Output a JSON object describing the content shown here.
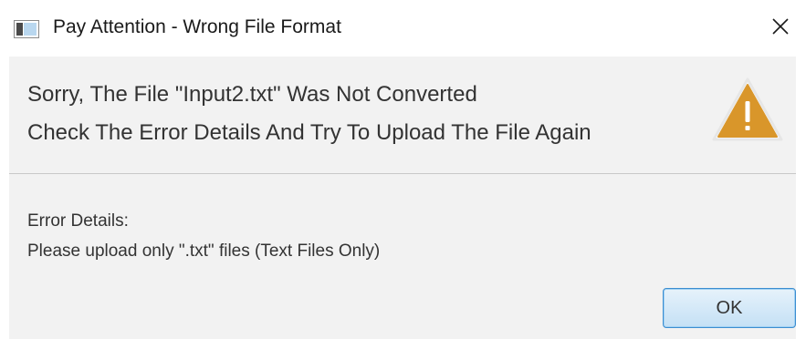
{
  "window": {
    "title": "Pay Attention - Wrong File Format",
    "app_icon": "java-window-icon",
    "close_icon": "close-icon"
  },
  "header": {
    "line1": "Sorry, The File \"Input2.txt\" Was Not Converted",
    "line2": "Check The Error Details And Try To Upload The File Again",
    "icon": "warning-icon",
    "icon_color": "#d9962a"
  },
  "content": {
    "label": "Error Details:",
    "message": "Please upload only \".txt\" files (Text Files Only)"
  },
  "buttons": {
    "ok_label": "OK"
  },
  "colors": {
    "panel_background": "#f2f2f2",
    "default_button_border": "#3c8dd0"
  }
}
